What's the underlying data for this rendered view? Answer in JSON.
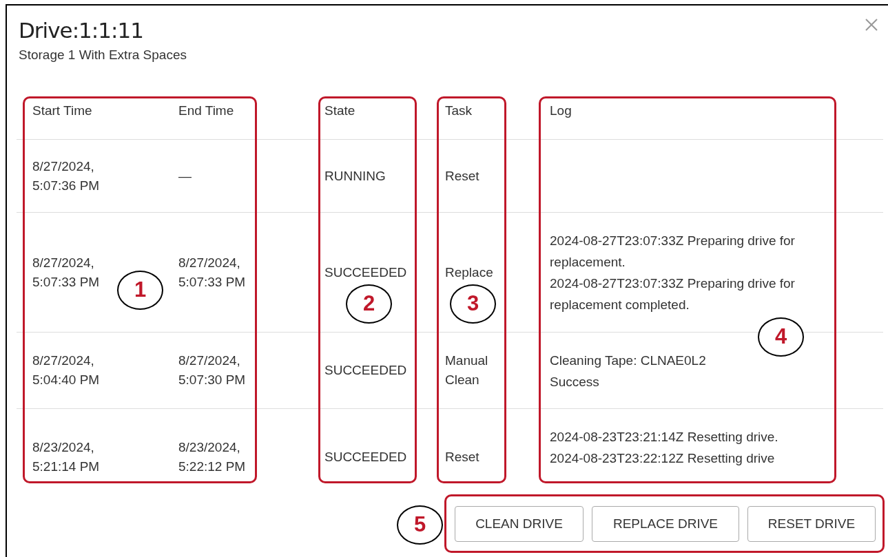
{
  "dialog": {
    "title": "Drive:1:1:11",
    "subtitle": "Storage 1 With Extra Spaces"
  },
  "table": {
    "columns": [
      "Start Time",
      "End Time",
      "State",
      "Task",
      "Log"
    ],
    "rows": [
      {
        "start_time": "8/27/2024, 5:07:36 PM",
        "end_time": "—",
        "state": "RUNNING",
        "task": "Reset"
      },
      {
        "start_time": "8/27/2024, 5:07:33 PM",
        "end_time": "8/27/2024, 5:07:33 PM",
        "state": "SUCCEEDED",
        "task": "Replace",
        "log": [
          "2024-08-27T23:07:33Z Preparing drive for replacement.",
          "2024-08-27T23:07:33Z Preparing drive for replacement completed."
        ]
      },
      {
        "start_time": "8/27/2024, 5:04:40 PM",
        "end_time": "8/27/2024, 5:07:30 PM",
        "state": "SUCCEEDED",
        "task": "Manual Clean",
        "log": [
          "Cleaning Tape: CLNAE0L2",
          "Success"
        ]
      },
      {
        "start_time": "8/23/2024, 5:21:14 PM",
        "end_time": "8/23/2024, 5:22:12 PM",
        "state": "SUCCEEDED",
        "task": "Reset",
        "log": [
          "2024-08-23T23:21:14Z Resetting drive.",
          "2024-08-23T23:22:12Z Resetting drive"
        ]
      }
    ]
  },
  "buttons": [
    "CLEAN DRIVE",
    "REPLACE DRIVE",
    "RESET DRIVE"
  ],
  "callouts": [
    "1",
    "2",
    "3",
    "4",
    "5"
  ]
}
